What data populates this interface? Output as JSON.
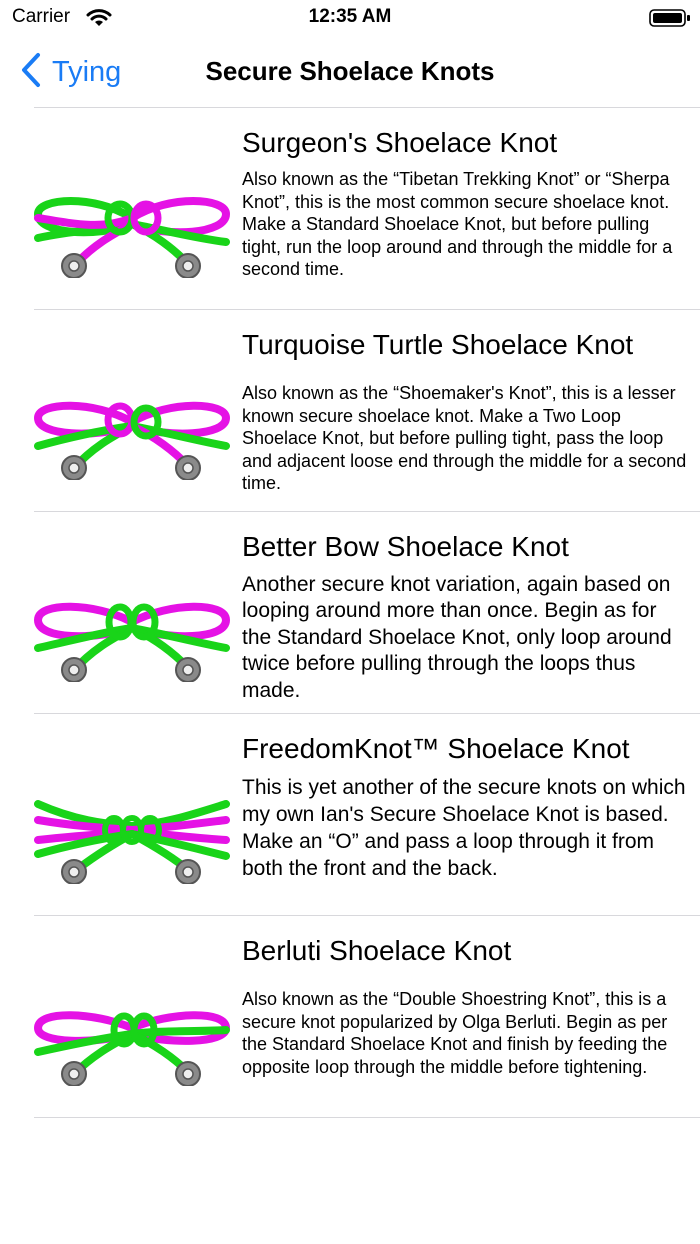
{
  "status_bar": {
    "carrier": "Carrier",
    "time": "12:35 AM"
  },
  "nav": {
    "back_label": "Tying",
    "title": "Secure Shoelace Knots"
  },
  "knots": [
    {
      "title": "Surgeon's Shoelace Knot",
      "description": "Also known as the “Tibetan Trekking Knot” or “Sherpa Knot”, this is the most common secure shoelace knot. Make a Standard Shoelace Knot, but before pulling tight, run the loop around and through the middle for a second time."
    },
    {
      "title": "Turquoise Turtle Shoelace Knot",
      "description": "Also known as the “Shoemaker's Knot”, this is a lesser known secure shoelace knot. Make a Two Loop Shoelace Knot, but before pulling tight, pass the loop and adjacent loose end through the middle for a second time."
    },
    {
      "title": "Better Bow Shoelace Knot",
      "description": "Another secure knot variation, again based on looping around more than once. Begin as for the Standard Shoelace Knot, only loop around twice before pulling through the loops thus made."
    },
    {
      "title": "FreedomKnot™ Shoelace Knot",
      "description": "This is yet another of the secure knots on which my own Ian's Secure Shoelace Knot is based. Make an “O” and pass a loop through it from both the front and the back."
    },
    {
      "title": "Berluti Shoelace Knot",
      "description": "Also known as the “Double Shoestring Knot”, this is a secure knot popularized by Olga Berluti. Begin as per the Standard Shoelace Knot and finish by feeding the opposite loop through the middle before tightening."
    }
  ],
  "colors": {
    "accent": "#1a7cf5",
    "lace_a": "#e512e5",
    "lace_b": "#19d419",
    "eyelet": "#8a8a8a"
  }
}
